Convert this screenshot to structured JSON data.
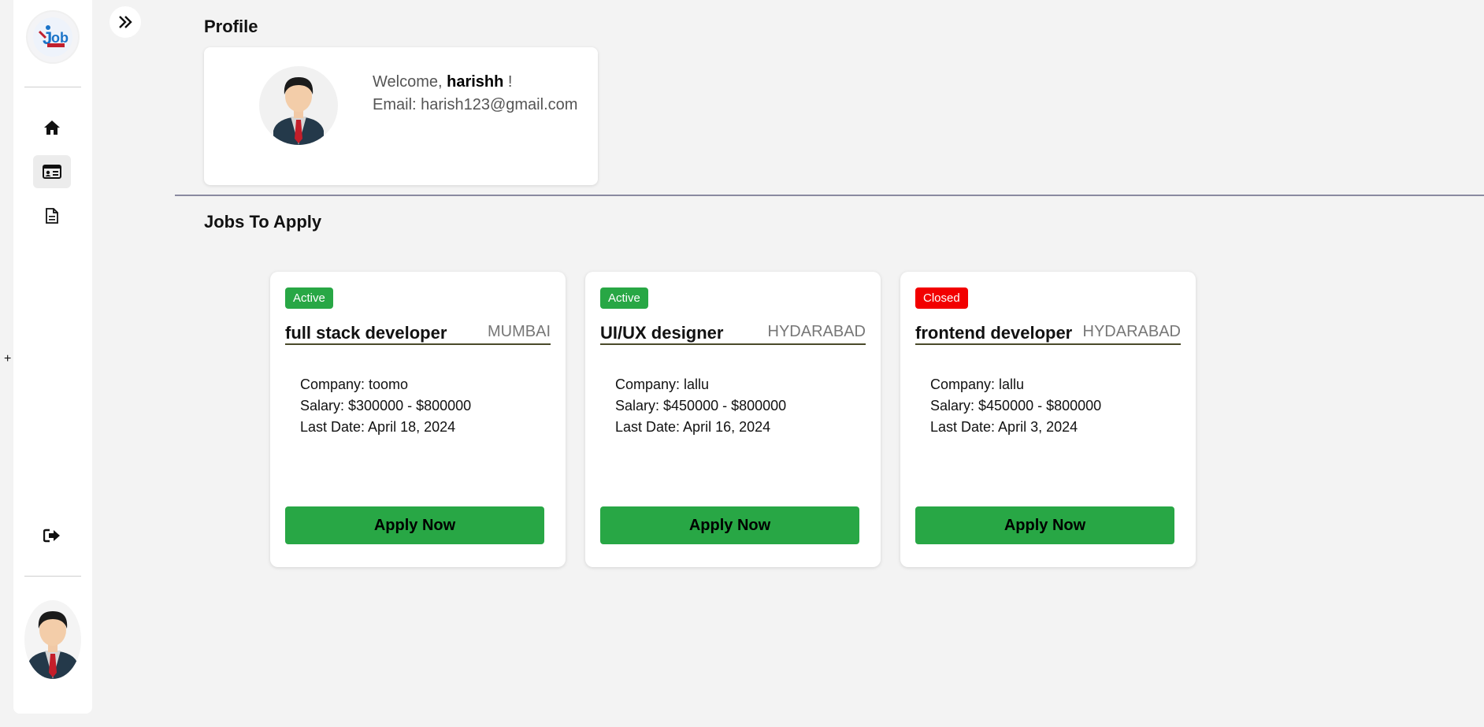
{
  "sidebar": {
    "logo_icon": "job-portal-logo",
    "nav": [
      {
        "icon": "home-icon",
        "active": false
      },
      {
        "icon": "id-card-icon",
        "active": true
      },
      {
        "icon": "document-icon",
        "active": false
      }
    ],
    "logout_icon": "logout-icon",
    "avatar_icon": "user-avatar"
  },
  "misc": {
    "plus": "+"
  },
  "profile": {
    "section_title": "Profile",
    "welcome_prefix": "Welcome, ",
    "username": "harishh",
    "welcome_suffix": " !",
    "email_label": "Email: ",
    "email": "harish123@gmail.com"
  },
  "jobs": {
    "section_title": "Jobs To Apply",
    "items": [
      {
        "status": "Active",
        "title": "full stack developer",
        "location": "MUMBAI",
        "company": "Company: toomo",
        "salary": "Salary: $300000 - $800000",
        "last_date": "Last Date: April 18, 2024",
        "button": "Apply Now"
      },
      {
        "status": "Active",
        "title": "UI/UX designer",
        "location": "HYDARABAD",
        "company": "Company: lallu",
        "salary": "Salary: $450000 - $800000",
        "last_date": "Last Date: April 16, 2024",
        "button": "Apply Now"
      },
      {
        "status": "Closed",
        "title": "frontend developer",
        "location": "HYDARABAD",
        "company": "Company: lallu",
        "salary": "Salary: $450000 - $800000",
        "last_date": "Last Date: April 3, 2024",
        "button": "Apply Now"
      }
    ]
  },
  "colors": {
    "accent_green": "#28a745",
    "closed_red": "#f20000",
    "background": "#f3f3f3"
  }
}
